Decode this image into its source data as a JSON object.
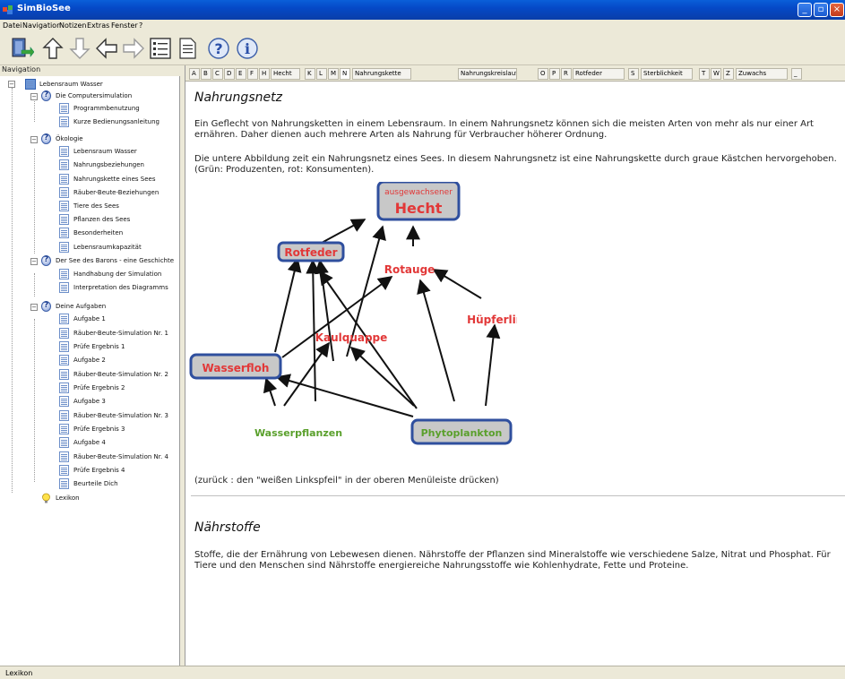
{
  "window": {
    "title": "SimBioSee"
  },
  "menu": [
    "Datei",
    "Navigation",
    "Notizen",
    "Extras",
    "Fenster",
    "?"
  ],
  "nav": {
    "header": "Navigation",
    "items": [
      "Lebensraum Wasser",
      "Die Computersimulation",
      "Programmbenutzung",
      "Kurze Bedienungsanleitung",
      "Ökologie",
      "Lebensraum Wasser",
      "Nahrungsbeziehungen",
      "Nahrungskette eines Sees",
      "Räuber-Beute-Beziehungen",
      "Tiere des Sees",
      "Pflanzen des Sees",
      "Besonderheiten",
      "Lebensraumkapazität",
      "Der See des Barons - eine Geschichte",
      "Handhabung der Simulation",
      "Interpretation des Diagramms",
      "Deine Aufgaben",
      "Aufgabe 1",
      "Räuber-Beute-Simulation Nr. 1",
      "Prüfe Ergebnis 1",
      "Aufgabe 2",
      "Räuber-Beute-Simulation Nr. 2",
      "Prüfe Ergebnis 2",
      "Aufgabe 3",
      "Räuber-Beute-Simulation Nr. 3",
      "Prüfe Ergebnis 3",
      "Aufgabe 4",
      "Räuber-Beute-Simulation Nr. 4",
      "Prüfe Ergebnis 4",
      "Beurteile Dich",
      "Lexikon"
    ]
  },
  "tabs": [
    "A",
    "B",
    "C",
    "D",
    "E",
    "F",
    "H",
    "Hecht",
    "K",
    "L",
    "M",
    "N",
    "Nahrungskette",
    "Nahrungskreislauf",
    "O",
    "P",
    "R",
    "Rotfeder",
    "S",
    "Sterblichkeit",
    "T",
    "W",
    "Z",
    "Zuwachs",
    "_"
  ],
  "entry1": {
    "title": "Nahrungsnetz",
    "p1": "Ein Geflecht von Nahrungsketten in einem Lebensraum. In einem Nahrungsnetz können sich die meisten Arten von mehr als nur einer Art ernähren. Daher dienen auch mehrere Arten als Nahrung für Verbraucher höherer Ordnung.",
    "p2": "Die untere Abbildung zeit ein Nahrungsnetz eines Sees. In diesem Nahrungsnetz ist eine Nahrungskette durch graue Kästchen hervorgehoben. (Grün: Produzenten, rot: Konsumenten).",
    "back": "(zurück : den \"weißen Linkspfeil\" in der oberen Menüleiste drücken)"
  },
  "diagram": {
    "hecht_small": "ausgewachsener",
    "hecht": "Hecht",
    "rotfeder": "Rotfeder",
    "rotauge": "Rotauge",
    "huepferling": "Hüpferling",
    "kaulquappe": "Kaulquappe",
    "wasserfloh": "Wasserfloh",
    "wasserpflanzen": "Wasserpflanzen",
    "phytoplankton": "Phytoplankton",
    "colors": {
      "consumer": "#e23838",
      "producer": "#5aa02c",
      "box_border": "#2f4f9e",
      "box_fill": "#c8c8c8"
    }
  },
  "entry2": {
    "title": "Nährstoffe",
    "p1": "Stoffe, die der Ernährung von Lebewesen dienen. Nährstoffe der Pflanzen sind Mineralstoffe wie verschiedene Salze, Nitrat und Phosphat. Für Tiere und den Menschen sind Nährstoffe energiereiche Nahrungsstoffe wie Kohlenhydrate, Fette und Proteine."
  },
  "status": {
    "text": "Lexikon"
  }
}
